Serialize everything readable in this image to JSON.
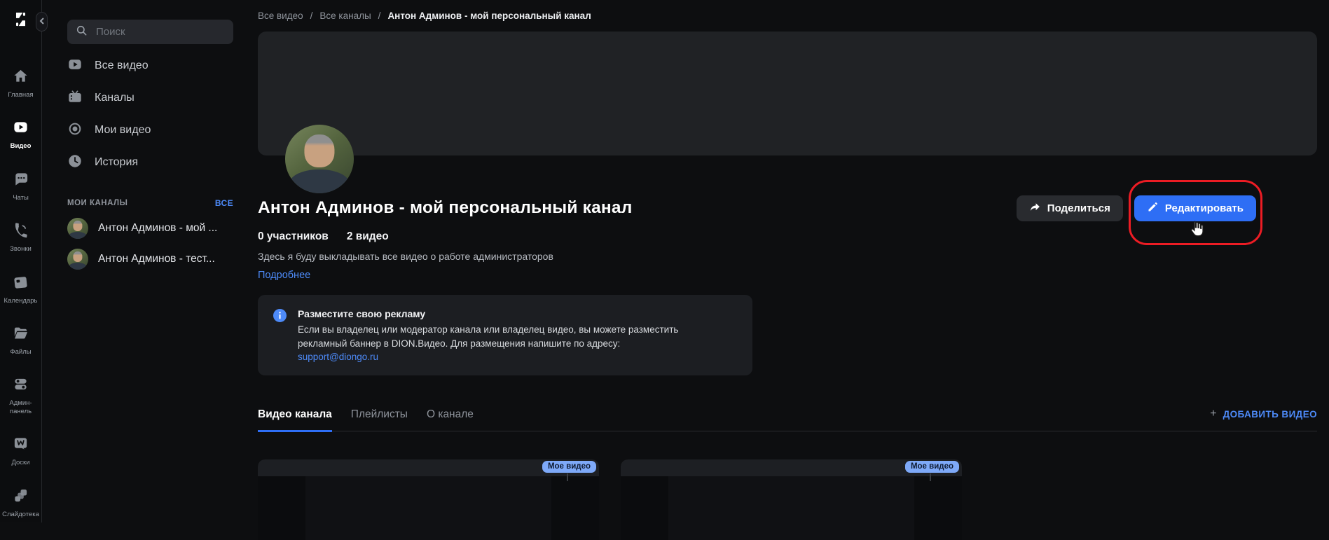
{
  "colors": {
    "accent_blue": "#2e6ef5",
    "link_blue": "#4d8af8",
    "badge_blue": "#7ea9f8",
    "annotation_red": "#ec1c24"
  },
  "rail": {
    "items": [
      {
        "label": "Главная",
        "icon": "home-icon",
        "active": false
      },
      {
        "label": "Видео",
        "icon": "video-icon",
        "active": true
      },
      {
        "label": "Чаты",
        "icon": "chat-icon",
        "active": false
      },
      {
        "label": "Звонки",
        "icon": "phone-icon",
        "active": false
      },
      {
        "label": "Календарь",
        "icon": "calendar-icon",
        "active": false
      },
      {
        "label": "Файлы",
        "icon": "folder-icon",
        "active": false
      },
      {
        "label": "Админ-панель",
        "icon": "toggles-icon",
        "active": false
      },
      {
        "label": "Доски",
        "icon": "boards-icon",
        "active": false
      },
      {
        "label": "Слайдотека",
        "icon": "slides-icon",
        "active": false
      }
    ]
  },
  "sidebar": {
    "search_placeholder": "Поиск",
    "menu": [
      {
        "label": "Все видео",
        "icon": "play-icon"
      },
      {
        "label": "Каналы",
        "icon": "tv-icon"
      },
      {
        "label": "Мои видео",
        "icon": "record-icon"
      },
      {
        "label": "История",
        "icon": "history-icon"
      }
    ],
    "my_channels": {
      "label": "МОИ КАНАЛЫ",
      "all_link": "ВСЕ",
      "channels": [
        {
          "name": "Антон Админов - мой ..."
        },
        {
          "name": "Антон Админов - тест..."
        }
      ]
    }
  },
  "breadcrumb": {
    "separator": "/",
    "items": [
      "Все видео",
      "Все каналы",
      "Антон Админов - мой персональный канал"
    ]
  },
  "channel": {
    "title": "Антон Админов - мой персональный канал",
    "members": "0 участников",
    "videos_count": "2 видео",
    "description": "Здесь я буду выкладывать все видео о работе администраторов",
    "more_link": "Подробнее",
    "share_button": "Поделиться",
    "edit_button": "Редактировать"
  },
  "ad_notice": {
    "title": "Разместите свою рекламу",
    "body": "Если вы владелец или модератор канала или владелец видео, вы можете разместить рекламный баннер в DION.Видео. Для размещения напишите по адресу:",
    "email": "support@diongo.ru"
  },
  "tabs": {
    "items": [
      {
        "label": "Видео канала",
        "active": true
      },
      {
        "label": "Плейлисты",
        "active": false
      },
      {
        "label": "О канале",
        "active": false
      }
    ],
    "add_video_plus": "+",
    "add_video_label": "ДОБАВИТЬ ВИДЕО"
  },
  "video_grid": {
    "cards": [
      {
        "badge": "Мое видео"
      },
      {
        "badge": "Мое видео"
      }
    ]
  }
}
